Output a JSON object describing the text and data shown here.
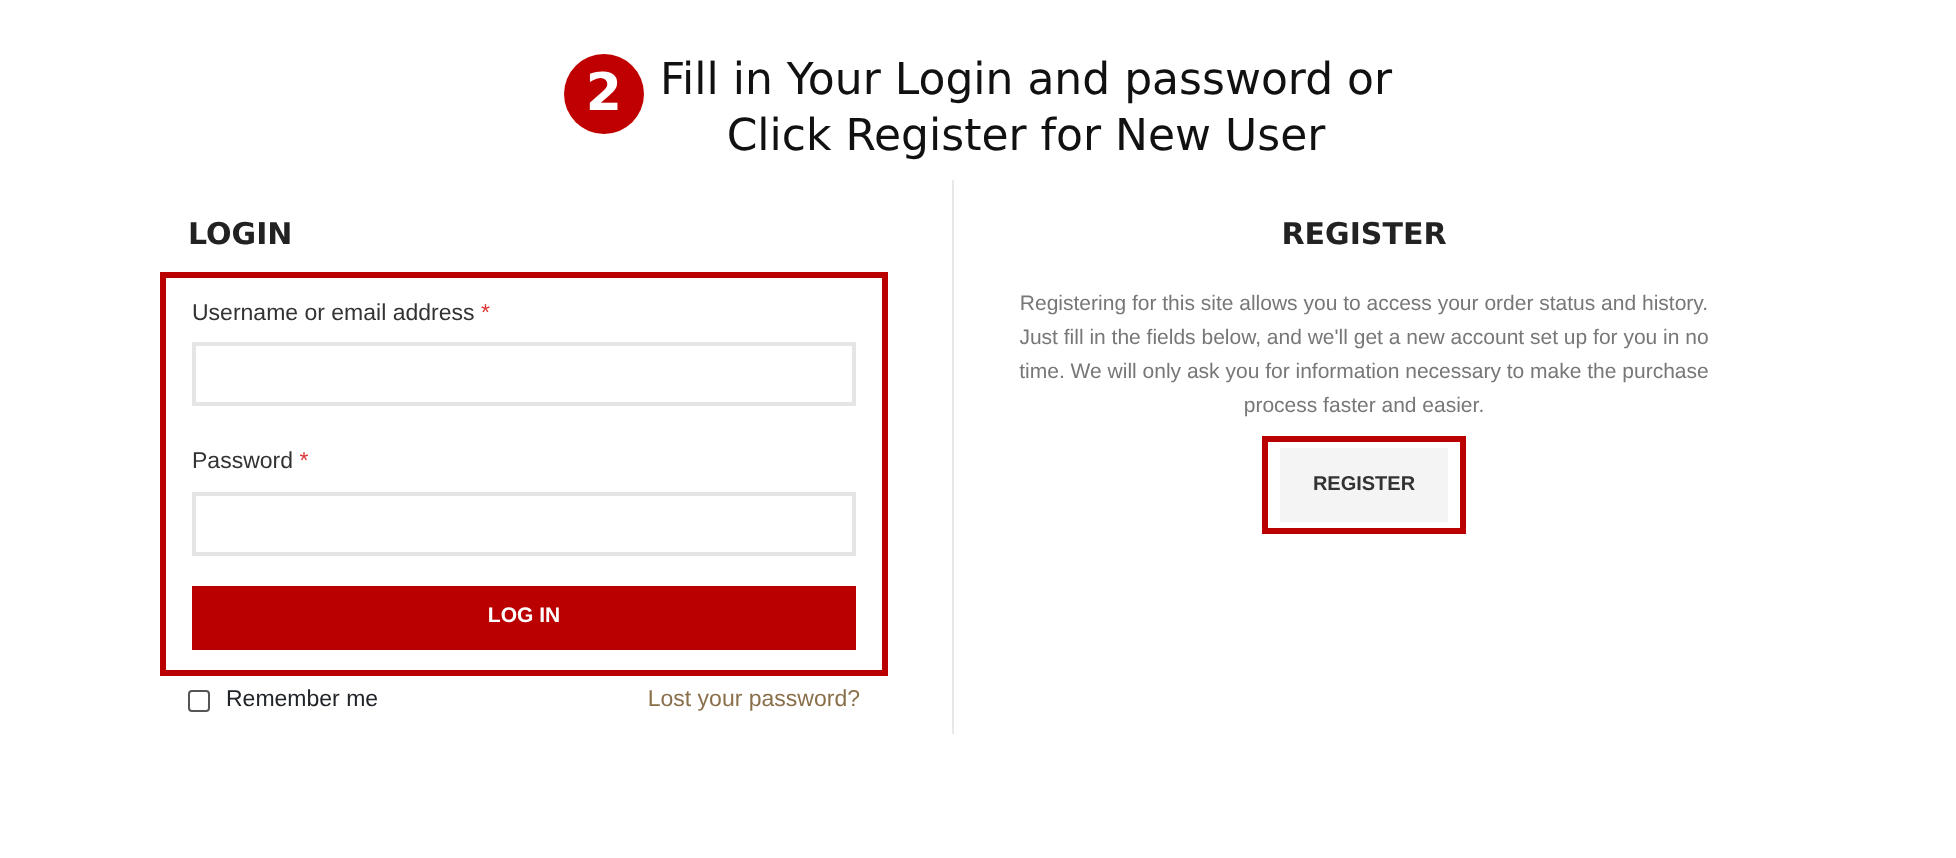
{
  "step": {
    "number": "2",
    "lines": [
      "Fill in Your Login and password or",
      "Click Register for New User"
    ]
  },
  "login": {
    "heading": "LOGIN",
    "highlighted": true,
    "fields": [
      {
        "label": "Username or email address",
        "required_mark": "*"
      },
      {
        "label": "Password",
        "required_mark": "*"
      }
    ],
    "button": "LOG IN",
    "remember": {
      "label": "Remember me",
      "checked": false
    },
    "lost_link": "Lost your password?"
  },
  "register": {
    "heading": "REGISTER",
    "text": "Registering for this site allows you to access your order status and history. Just fill in the fields below, and we'll get a new account set up for you in no time. We will only ask you for information necessary to make the purchase process faster and easier.",
    "button": "REGISTER",
    "highlighted": true
  }
}
